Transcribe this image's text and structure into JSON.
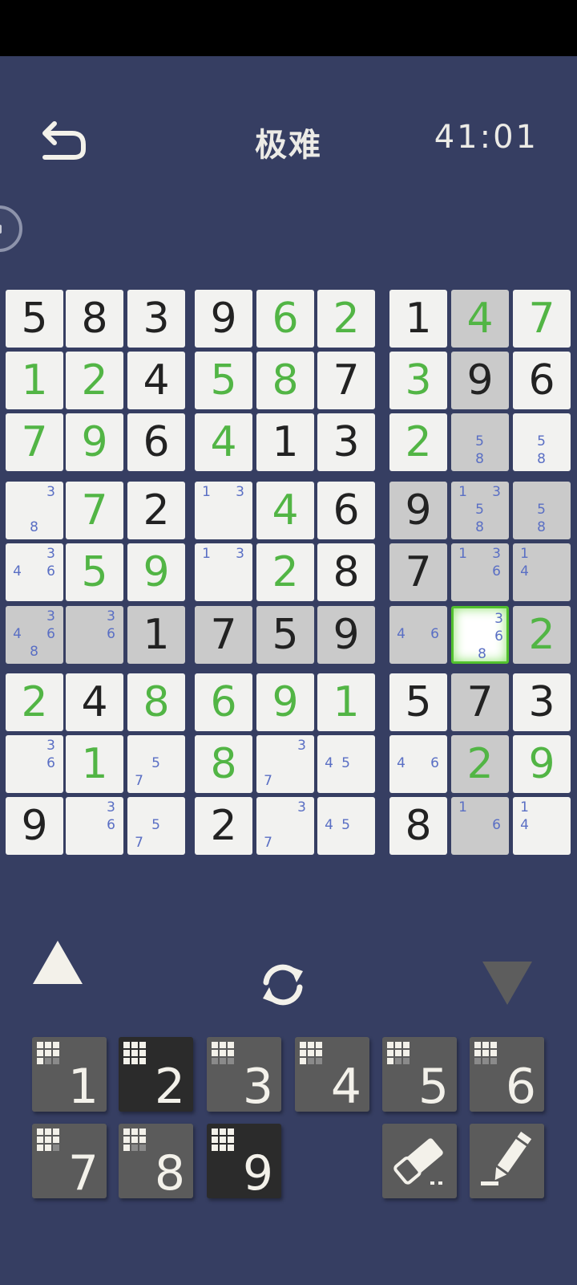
{
  "header": {
    "title": "极难",
    "timer": "41:01"
  },
  "board": {
    "selected": [
      5,
      7
    ],
    "rows": [
      [
        {
          "v": "5"
        },
        {
          "v": "8"
        },
        {
          "v": "3"
        },
        {
          "v": "9"
        },
        {
          "v": "6",
          "g": 1
        },
        {
          "v": "2",
          "g": 1
        },
        {
          "v": "1"
        },
        {
          "v": "4",
          "g": 1,
          "h": 1
        },
        {
          "v": "7",
          "g": 1
        }
      ],
      [
        {
          "v": "1",
          "g": 1
        },
        {
          "v": "2",
          "g": 1
        },
        {
          "v": "4"
        },
        {
          "v": "5",
          "g": 1
        },
        {
          "v": "8",
          "g": 1
        },
        {
          "v": "7"
        },
        {
          "v": "3",
          "g": 1
        },
        {
          "v": "9",
          "h": 1
        },
        {
          "v": "6"
        }
      ],
      [
        {
          "v": "7",
          "g": 1
        },
        {
          "v": "9",
          "g": 1
        },
        {
          "v": "6"
        },
        {
          "v": "4",
          "g": 1
        },
        {
          "v": "1"
        },
        {
          "v": "3"
        },
        {
          "v": "2",
          "g": 1
        },
        {
          "n": [
            5,
            8
          ],
          "h": 1
        },
        {
          "n": [
            5,
            8
          ]
        }
      ],
      [
        {
          "n": [
            3,
            8
          ]
        },
        {
          "v": "7",
          "g": 1
        },
        {
          "v": "2"
        },
        {
          "n": [
            1,
            3
          ]
        },
        {
          "v": "4",
          "g": 1
        },
        {
          "v": "6"
        },
        {
          "v": "9",
          "h": 1
        },
        {
          "n": [
            1,
            3,
            5,
            8
          ],
          "h": 1
        },
        {
          "n": [
            5,
            8
          ],
          "h": 1
        }
      ],
      [
        {
          "n": [
            3,
            4,
            6
          ]
        },
        {
          "v": "5",
          "g": 1
        },
        {
          "v": "9",
          "g": 1
        },
        {
          "n": [
            1,
            3
          ]
        },
        {
          "v": "2",
          "g": 1
        },
        {
          "v": "8"
        },
        {
          "v": "7",
          "h": 1
        },
        {
          "n": [
            1,
            3,
            6
          ],
          "h": 1
        },
        {
          "n": [
            1,
            4
          ],
          "h": 1
        }
      ],
      [
        {
          "n": [
            3,
            4,
            6,
            8
          ],
          "h": 1
        },
        {
          "n": [
            3,
            6
          ],
          "h": 1
        },
        {
          "v": "1",
          "h": 1
        },
        {
          "v": "7",
          "h": 1
        },
        {
          "v": "5",
          "h": 1
        },
        {
          "v": "9",
          "h": 1
        },
        {
          "n": [
            4,
            6
          ],
          "h": 1
        },
        {
          "n": [
            3,
            6,
            8
          ]
        },
        {
          "v": "2",
          "g": 1,
          "h": 1
        }
      ],
      [
        {
          "v": "2",
          "g": 1
        },
        {
          "v": "4"
        },
        {
          "v": "8",
          "g": 1
        },
        {
          "v": "6",
          "g": 1
        },
        {
          "v": "9",
          "g": 1
        },
        {
          "v": "1",
          "g": 1
        },
        {
          "v": "5"
        },
        {
          "v": "7",
          "h": 1
        },
        {
          "v": "3"
        }
      ],
      [
        {
          "n": [
            3,
            6
          ]
        },
        {
          "v": "1",
          "g": 1
        },
        {
          "n": [
            5,
            7
          ]
        },
        {
          "v": "8",
          "g": 1
        },
        {
          "n": [
            3,
            7
          ]
        },
        {
          "n": [
            4,
            5
          ]
        },
        {
          "n": [
            4,
            6
          ]
        },
        {
          "v": "2",
          "g": 1,
          "h": 1
        },
        {
          "v": "9",
          "g": 1
        }
      ],
      [
        {
          "v": "9"
        },
        {
          "n": [
            3,
            6
          ]
        },
        {
          "n": [
            5,
            7
          ]
        },
        {
          "v": "2"
        },
        {
          "n": [
            3,
            7
          ]
        },
        {
          "n": [
            4,
            5
          ]
        },
        {
          "v": "8"
        },
        {
          "n": [
            1,
            6
          ],
          "h": 1
        },
        {
          "n": [
            1,
            4
          ]
        }
      ]
    ]
  },
  "controls": {
    "keys": [
      {
        "num": "1",
        "dark": false,
        "remaining": 2
      },
      {
        "num": "2",
        "dark": true,
        "remaining": 0
      },
      {
        "num": "3",
        "dark": false,
        "remaining": 3
      },
      {
        "num": "4",
        "dark": false,
        "remaining": 2
      },
      {
        "num": "5",
        "dark": false,
        "remaining": 2
      },
      {
        "num": "6",
        "dark": false,
        "remaining": 3
      },
      {
        "num": "7",
        "dark": false,
        "remaining": 1
      },
      {
        "num": "8",
        "dark": false,
        "remaining": 2
      },
      {
        "num": "9",
        "dark": true,
        "remaining": 0
      }
    ],
    "tools": [
      "eraser-icon",
      "pencil-icon"
    ]
  },
  "colors": {
    "background": "#363e62",
    "given": "#222222",
    "entered": "#52b545",
    "note": "#5a6fc4",
    "highlight": "#cacaca",
    "selected_border": "#52c12e"
  }
}
